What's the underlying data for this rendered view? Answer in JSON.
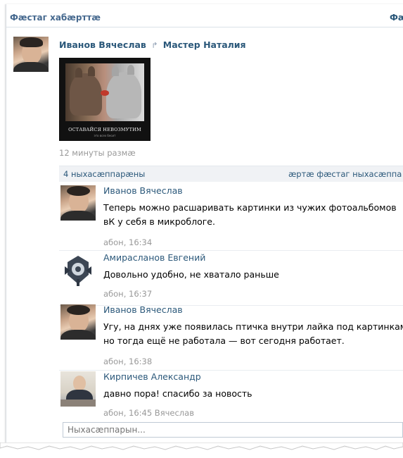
{
  "header": {
    "title": "Фæстаг хабæрттæ",
    "right_link": "Фæ"
  },
  "post": {
    "author": "Иванов Вячеслав",
    "reposted_from": "Мастер Наталия",
    "image_caption": "ОСТАВАЙСЯ НЕВОЗМУТИМ",
    "image_subcaption": "это всех бесит",
    "time": "12 минуты размæ"
  },
  "comments_bar": {
    "count": "4 ныхасæппарæны",
    "older_link": "æртæ фæстаг ныхасæппа"
  },
  "comments": [
    {
      "name": "Иванов Вячеслав",
      "text": "Теперь можно расшаривать картинки из чужих фотоальбомов вК у себя в микроблоге.",
      "time": "абон, 16:34"
    },
    {
      "name": "Амирасланов Евгений",
      "text": "Довольно удобно, не хватало раньше",
      "time": "абон, 16:37"
    },
    {
      "name": "Иванов Вячеслав",
      "text": "Угу, на днях уже появилась птичка внутри лайка под картинками, но тогда ещё не работала — вот сегодня работает.",
      "time": "абон, 16:38"
    },
    {
      "name": "Кирпичев Александр",
      "text": "давно пора! спасибо за новость",
      "time": "абон, 16:45 Вячеслав"
    }
  ],
  "reply": {
    "placeholder": "Ныхасæппарын..."
  },
  "icons": {
    "repost": "repost-arrow-icon"
  },
  "colors": {
    "link": "#2b587a",
    "header": "#45688e",
    "muted": "#999999",
    "bar": "#f0f2f5"
  }
}
